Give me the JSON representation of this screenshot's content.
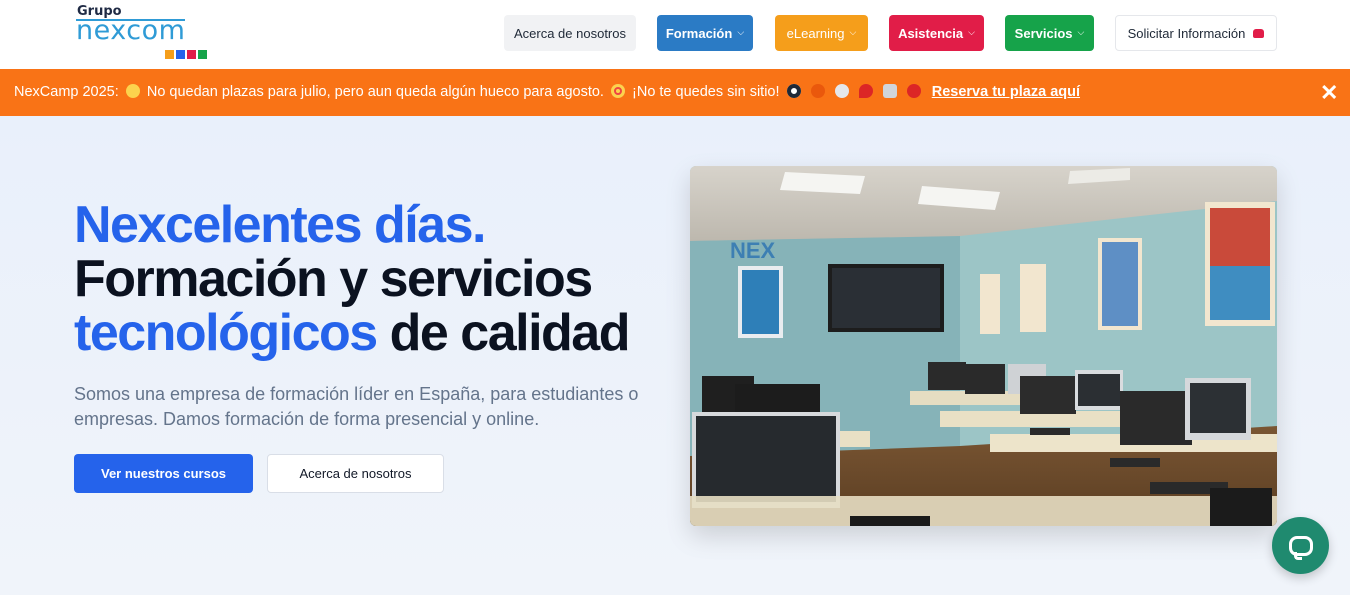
{
  "logo": {
    "top": "Grupo",
    "brand": "nexcom",
    "square_colors": [
      "#f59e1b",
      "#2563eb",
      "#e11d48",
      "#16a34a"
    ]
  },
  "nav": {
    "about": "Acerca de nosotros",
    "formacion": "Formación",
    "elearning": "eLearning",
    "asistencia": "Asistencia",
    "servicios": "Servicios",
    "solicitar": "Solicitar Información",
    "colors": {
      "formacion": "#2b7bc5",
      "elearning": "#f59e1b",
      "asistencia": "#e11d48",
      "servicios": "#16a34a"
    }
  },
  "banner": {
    "part1": "NexCamp 2025:",
    "part2": "No quedan plazas para julio, pero aun queda algún hueco para agosto.",
    "part3": "¡No te quedes sin sitio!",
    "link": "Reserva tu plaza aquí",
    "close": "✕",
    "color": "#f97316"
  },
  "hero": {
    "line1": "Nexcelentes días.",
    "line2": "Formación y servicios",
    "line3_blue": "tecnológicos",
    "line3_rest": " de calidad",
    "subtitle": "Somos una empresa de formación líder en España, para estudiantes o empresas. Damos formación de forma presencial y online.",
    "primary_button": "Ver nuestros cursos",
    "secondary_button": "Acerca de nosotros"
  },
  "photo": {
    "wall_sign": "NEX"
  }
}
